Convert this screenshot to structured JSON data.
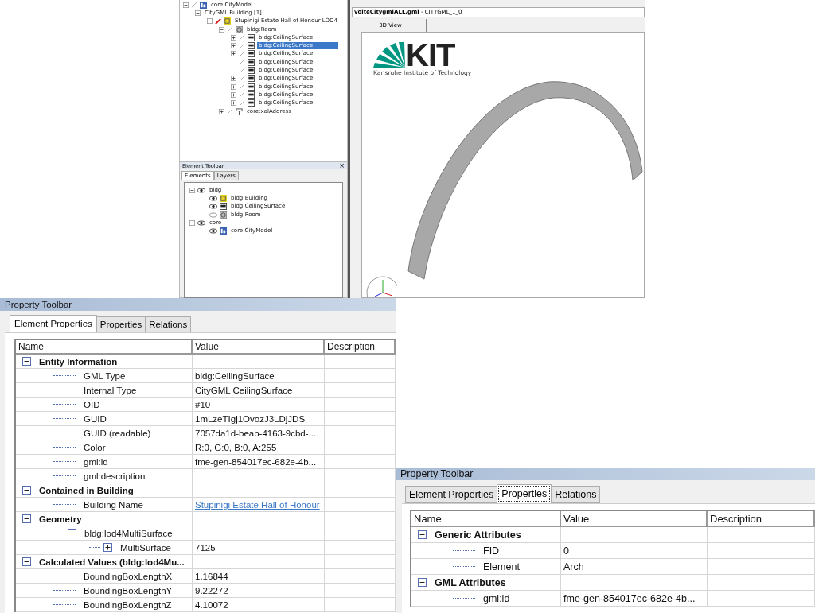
{
  "model_tree": {
    "items": [
      {
        "label": "core:CityModel",
        "kind": "citymodel",
        "expanded": true,
        "selected": false,
        "children": [
          {
            "label": "CityGML Building [1]",
            "expanded": true,
            "selected": false,
            "children": [
              {
                "label": "Stupinigi Estate Hall of Honour LOD4",
                "kind": "building",
                "expanded": true,
                "selected": false,
                "children": [
                  {
                    "label": "bldg:Room",
                    "kind": "room",
                    "expanded": true,
                    "selected": false,
                    "children": [
                      {
                        "label": "bldg:CeilingSurface",
                        "kind": "surface",
                        "expanded": false,
                        "selected": false
                      },
                      {
                        "label": "bldg:CeilingSurface",
                        "kind": "surface",
                        "expanded": false,
                        "selected": true
                      },
                      {
                        "label": "bldg:CeilingSurface",
                        "kind": "surface",
                        "expanded": false,
                        "selected": false
                      },
                      {
                        "label": "bldg:CeilingSurface",
                        "kind": "surface",
                        "selected": false
                      },
                      {
                        "label": "bldg:CeilingSurface",
                        "kind": "surface",
                        "selected": false
                      },
                      {
                        "label": "bldg:CeilingSurface",
                        "kind": "surface",
                        "expanded": false,
                        "selected": false
                      },
                      {
                        "label": "bldg:CeilingSurface",
                        "kind": "surface",
                        "expanded": false,
                        "selected": false
                      },
                      {
                        "label": "bldg:CeilingSurface",
                        "kind": "surface",
                        "expanded": false,
                        "selected": false
                      },
                      {
                        "label": "bldg:CeilingSurface",
                        "kind": "surface",
                        "expanded": false,
                        "selected": false
                      }
                    ]
                  },
                  {
                    "label": "core:xalAddress",
                    "kind": "address",
                    "expanded": false,
                    "selected": false
                  }
                ]
              }
            ]
          }
        ]
      }
    ]
  },
  "element_toolbar": {
    "title": "Element Toolbar",
    "close": "×",
    "tabs": [
      {
        "label": "Elements",
        "selected": true
      },
      {
        "label": "Layers",
        "selected": false
      }
    ],
    "items": [
      {
        "label": "bldg",
        "visible": true,
        "expanded": true,
        "children": [
          {
            "label": "bldg:Building",
            "kind": "building",
            "visible": true
          },
          {
            "label": "bldg:CeilingSurface",
            "kind": "surface",
            "visible": true
          },
          {
            "label": "bldg:Room",
            "kind": "room",
            "visible": false
          }
        ]
      },
      {
        "label": "core",
        "visible": true,
        "expanded": true,
        "children": [
          {
            "label": "core:CityModel",
            "kind": "citymodel",
            "visible": true
          }
        ]
      }
    ]
  },
  "view": {
    "title": "**volteCitygmlALL.gml** - CITYGML_1_0",
    "tabs": [
      {
        "label": "3D View"
      }
    ],
    "logo": {
      "text": "KIT",
      "subtitle": "Karlsruhe Institute of Technology"
    }
  },
  "property_panels": [
    {
      "title": "Property Toolbar",
      "tabs": [
        {
          "label": "Element Properties",
          "selected": true
        },
        {
          "label": "Properties",
          "selected": false
        },
        {
          "label": "Relations",
          "selected": false
        }
      ],
      "columns": [
        "Name",
        "Value",
        "Description"
      ],
      "rows": [
        {
          "kind": "group",
          "name": "Entity Information",
          "expanded": true,
          "children": [
            {
              "kind": "field",
              "name": "GML Type",
              "value": "bldg:CeilingSurface"
            },
            {
              "kind": "field",
              "name": "Internal Type",
              "value": "CityGML CeilingSurface"
            },
            {
              "kind": "field",
              "name": "OID",
              "value": "#10"
            },
            {
              "kind": "field",
              "name": "GUID",
              "value": "1mLzeTIgj1OvozJ3LDjJDS"
            },
            {
              "kind": "field",
              "name": "GUID (readable)",
              "value": "7057da1d-beab-4163-9cbd-..."
            },
            {
              "kind": "field",
              "name": "Color",
              "value": "R:0, G:0, B:0, A:255"
            },
            {
              "kind": "field",
              "name": "gml:id",
              "value": "fme-gen-854017ec-682e-4b..."
            },
            {
              "kind": "field",
              "name": "gml:description"
            }
          ]
        },
        {
          "kind": "group",
          "name": "Contained in Building",
          "expanded": true,
          "children": [
            {
              "kind": "link",
              "name": "Building Name",
              "value": "Stupinigi Estate Hall of Honour"
            }
          ]
        },
        {
          "kind": "group",
          "name": "Geometry",
          "expanded": true,
          "children": [
            {
              "name": "bldg:lod4MultiSurface",
              "expanded": true,
              "children": [
                {
                  "name": "MultiSurface",
                  "value": "7125",
                  "expanded": false
                }
              ]
            }
          ]
        },
        {
          "kind": "group",
          "name": "Calculated Values (bldg:lod4Mu...",
          "expanded": true,
          "children": [
            {
              "kind": "field",
              "name": "BoundingBoxLengthX",
              "value": "1.16844"
            },
            {
              "kind": "field",
              "name": "BoundingBoxLengthY",
              "value": "9.22272"
            },
            {
              "kind": "field",
              "name": "BoundingBoxLengthZ",
              "value": "4.10072"
            }
          ]
        }
      ]
    },
    {
      "title": "Property Toolbar",
      "tabs": [
        {
          "label": "Element Properties",
          "selected": false
        },
        {
          "label": "Properties",
          "selected": true
        },
        {
          "label": "Relations",
          "selected": false
        }
      ],
      "columns": [
        "Name",
        "Value",
        "Description"
      ],
      "rows": [
        {
          "kind": "group",
          "name": "Generic Attributes",
          "expanded": true,
          "children": [
            {
              "kind": "field",
              "name": "FID",
              "value": "0"
            },
            {
              "kind": "field",
              "name": "Element",
              "value": "Arch"
            }
          ]
        },
        {
          "kind": "group",
          "name": "GML Attributes",
          "expanded": true,
          "children": [
            {
              "kind": "field",
              "name": "gml:id",
              "value": "fme-gen-854017ec-682e-4b..."
            }
          ]
        }
      ]
    }
  ]
}
